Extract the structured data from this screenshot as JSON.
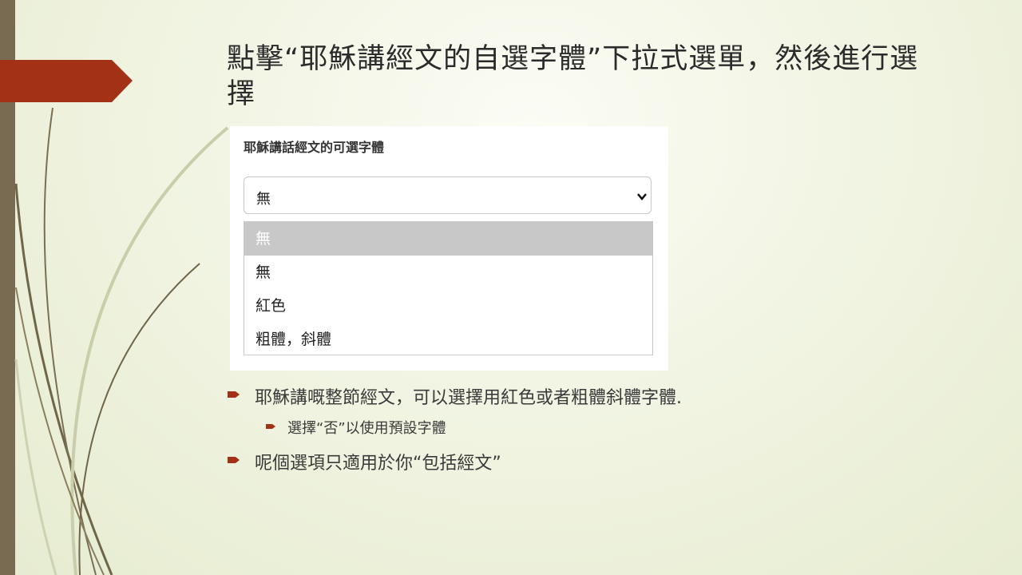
{
  "slide": {
    "title": "點擊“耶穌講經文的自選字體”下拉式選單，然後進行選擇",
    "accent_color": "#a33115",
    "sidebar_color": "#786b51"
  },
  "screenshot": {
    "label": "耶穌講話經文的可選字體",
    "select": {
      "current_value": "無",
      "icon": "chevron-down-icon"
    },
    "options": [
      "無",
      "無",
      "紅色",
      "粗體，斜體"
    ],
    "highlighted_index": 0
  },
  "bullets": [
    {
      "text": "耶穌講嘅整節經文，可以選擇用紅色或者粗體斜體字體.",
      "level": 1
    },
    {
      "text": "選擇“否”以使用預設字體",
      "level": 2
    },
    {
      "text": "呢個選項只適用於你“包括經文”",
      "level": 1
    }
  ]
}
